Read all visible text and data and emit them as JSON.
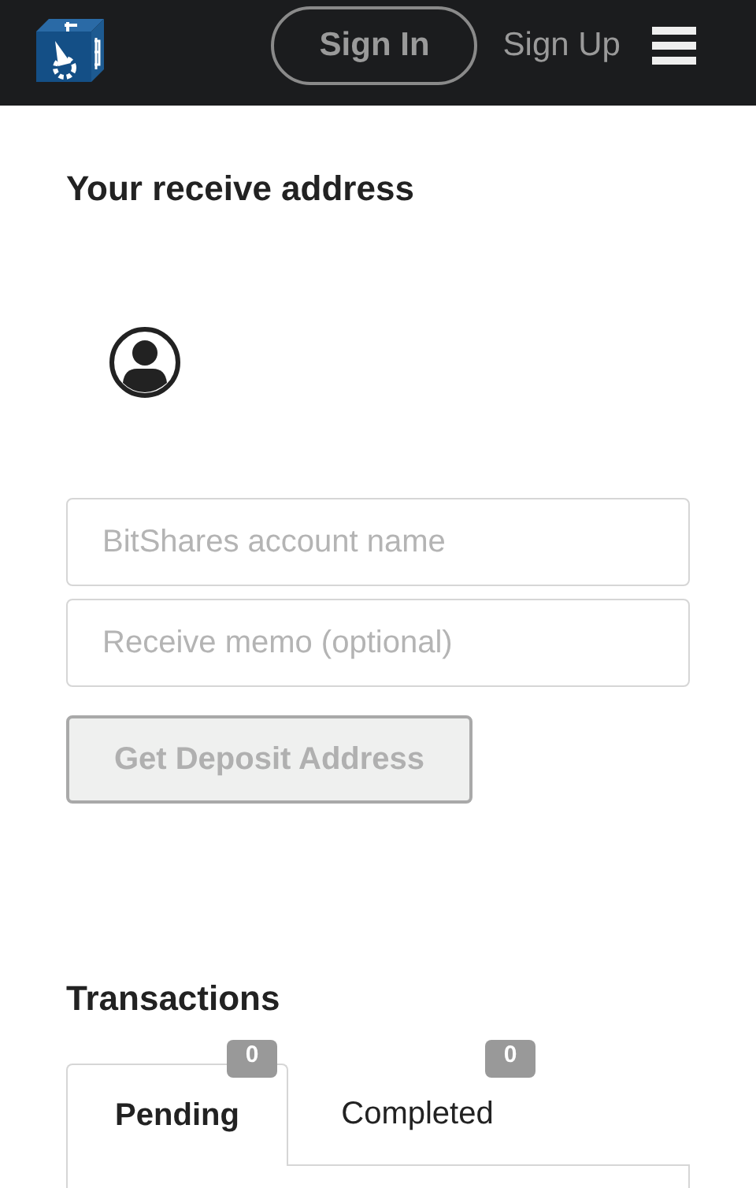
{
  "header": {
    "sign_in": "Sign In",
    "sign_up": "Sign Up"
  },
  "receive": {
    "title": "Your receive address",
    "fields": [
      {
        "placeholder": "BitShares account name"
      },
      {
        "placeholder": "Receive memo (optional)"
      }
    ],
    "button": {
      "label": "Get Deposit Address",
      "disabled": true
    }
  },
  "transactions": {
    "title": "Transactions",
    "tabs": [
      {
        "label": "Pending",
        "count": "0",
        "selected": true
      },
      {
        "label": "Completed",
        "count": "0",
        "selected": false
      }
    ]
  }
}
